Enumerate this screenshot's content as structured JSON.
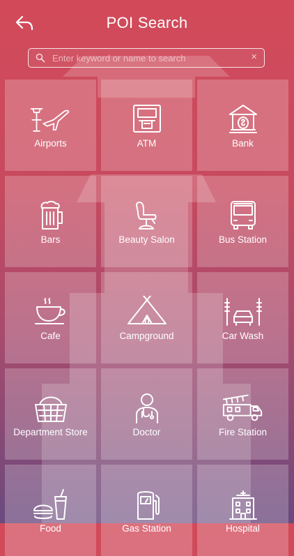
{
  "header": {
    "title": "POI Search"
  },
  "search": {
    "placeholder": "Enter keyword or name to search",
    "clear": "×"
  },
  "categories": [
    {
      "label": "Airports",
      "icon": "airport-icon"
    },
    {
      "label": "ATM",
      "icon": "atm-icon"
    },
    {
      "label": "Bank",
      "icon": "bank-icon"
    },
    {
      "label": "Bars",
      "icon": "beer-mug-icon"
    },
    {
      "label": "Beauty Salon",
      "icon": "salon-chair-icon"
    },
    {
      "label": "Bus Station",
      "icon": "bus-icon"
    },
    {
      "label": "Cafe",
      "icon": "coffee-cup-icon"
    },
    {
      "label": "Campground",
      "icon": "tent-icon"
    },
    {
      "label": "Car Wash",
      "icon": "car-wash-icon"
    },
    {
      "label": "Department Store",
      "icon": "shopping-basket-icon"
    },
    {
      "label": "Doctor",
      "icon": "doctor-icon"
    },
    {
      "label": "Fire Station",
      "icon": "fire-truck-icon"
    },
    {
      "label": "Food",
      "icon": "food-icon"
    },
    {
      "label": "Gas Station",
      "icon": "gas-pump-icon"
    },
    {
      "label": "Hospital",
      "icon": "hospital-icon"
    }
  ]
}
